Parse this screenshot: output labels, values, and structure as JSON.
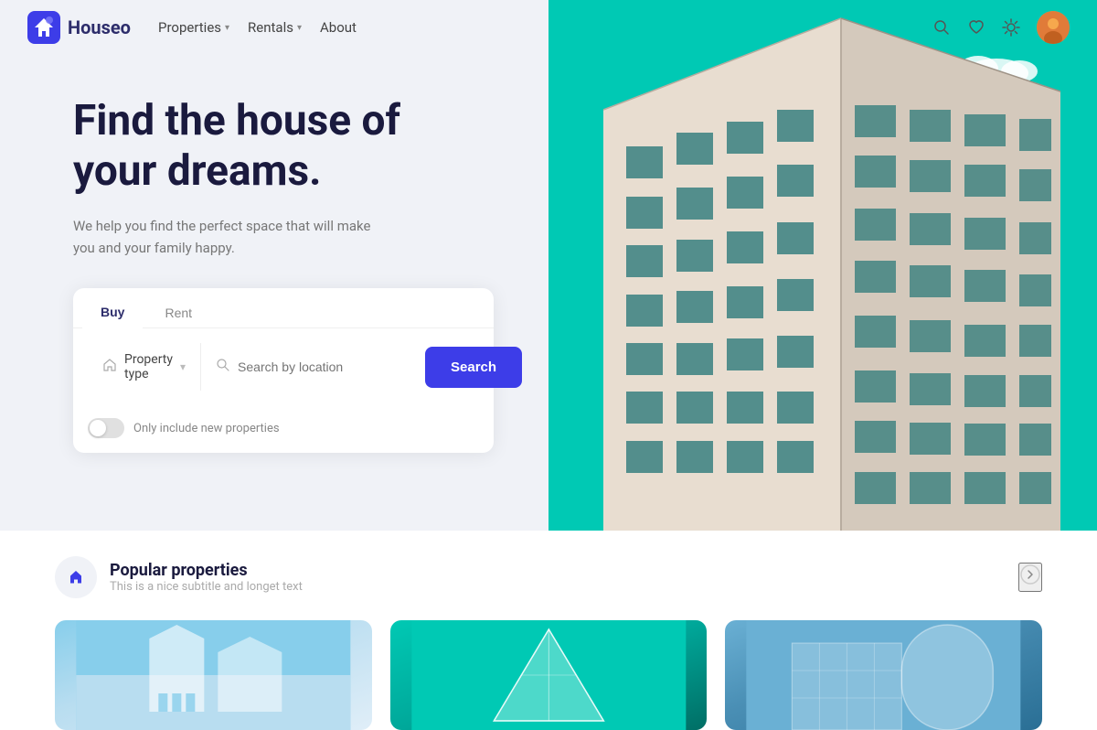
{
  "navbar": {
    "logo_text": "Houseo",
    "nav_items": [
      {
        "label": "Properties",
        "has_dropdown": true
      },
      {
        "label": "Rentals",
        "has_dropdown": true
      },
      {
        "label": "About",
        "has_dropdown": false
      }
    ],
    "icons": {
      "search": "🔍",
      "heart": "♡",
      "sun": "☀"
    }
  },
  "hero": {
    "title": "Find the house of your dreams.",
    "subtitle": "We help you find the perfect space that will make you and your family happy."
  },
  "search": {
    "tabs": [
      {
        "label": "Buy",
        "active": true
      },
      {
        "label": "Rent",
        "active": false
      }
    ],
    "property_type_label": "Property type",
    "location_placeholder": "Search by location",
    "search_button_label": "Search",
    "toggle_label": "Only include new properties"
  },
  "popular": {
    "icon": "🏠",
    "title": "Popular properties",
    "subtitle": "This is a nice subtitle and longet text"
  }
}
